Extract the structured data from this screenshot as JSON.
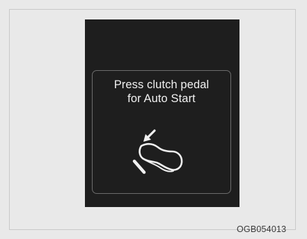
{
  "display": {
    "message_line1": "Press clutch pedal",
    "message_line2": "for Auto Start",
    "icon": "clutch-pedal-foot-icon"
  },
  "figure_code": "OGB054013"
}
